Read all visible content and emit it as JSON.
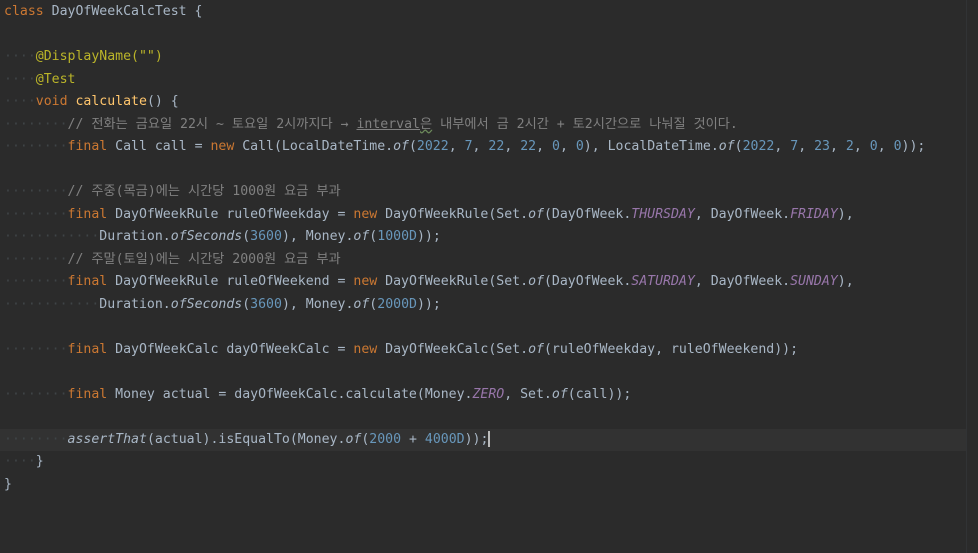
{
  "editor": {
    "file_language": "Java",
    "lines": [
      [
        [
          "kw",
          "class"
        ],
        [
          "t",
          " DayOfWeekCalcTest {"
        ]
      ],
      [],
      [
        [
          "ind",
          "····"
        ],
        [
          "anno",
          "@DisplayName(\"\")"
        ]
      ],
      [
        [
          "ind",
          "····"
        ],
        [
          "anno",
          "@Test"
        ]
      ],
      [
        [
          "ind",
          "····"
        ],
        [
          "kw",
          "void"
        ],
        [
          "t",
          " "
        ],
        [
          "fn",
          "calculate"
        ],
        [
          "t",
          "() {"
        ]
      ],
      [
        [
          "ind",
          "········"
        ],
        [
          "cmt",
          "// 전화는 금요일 22시 ~ 토요일 2시까지다 → "
        ],
        [
          "cmtlink",
          "interval"
        ],
        [
          "cmttypo",
          "은"
        ],
        [
          "cmt",
          " 내부에서 금 2시간 + 토2시간으로 나눠질 것이다."
        ]
      ],
      [
        [
          "ind",
          "········"
        ],
        [
          "kw",
          "final"
        ],
        [
          "t",
          " Call call = "
        ],
        [
          "kw",
          "new"
        ],
        [
          "t",
          " Call(LocalDateTime."
        ],
        [
          "it",
          "of"
        ],
        [
          "t",
          "("
        ],
        [
          "num",
          "2022"
        ],
        [
          "t",
          ", "
        ],
        [
          "num",
          "7"
        ],
        [
          "t",
          ", "
        ],
        [
          "num",
          "22"
        ],
        [
          "t",
          ", "
        ],
        [
          "num",
          "22"
        ],
        [
          "t",
          ", "
        ],
        [
          "num",
          "0"
        ],
        [
          "t",
          ", "
        ],
        [
          "num",
          "0"
        ],
        [
          "t",
          "), LocalDateTime."
        ],
        [
          "it",
          "of"
        ],
        [
          "t",
          "("
        ],
        [
          "num",
          "2022"
        ],
        [
          "t",
          ", "
        ],
        [
          "num",
          "7"
        ],
        [
          "t",
          ", "
        ],
        [
          "num",
          "23"
        ],
        [
          "t",
          ", "
        ],
        [
          "num",
          "2"
        ],
        [
          "t",
          ", "
        ],
        [
          "num",
          "0"
        ],
        [
          "t",
          ", "
        ],
        [
          "num",
          "0"
        ],
        [
          "t",
          "));"
        ]
      ],
      [],
      [
        [
          "ind",
          "········"
        ],
        [
          "cmt",
          "// 주중(목금)에는 시간당 1000원 요금 부과"
        ]
      ],
      [
        [
          "ind",
          "········"
        ],
        [
          "kw",
          "final"
        ],
        [
          "t",
          " DayOfWeekRule ruleOfWeekday = "
        ],
        [
          "kw",
          "new"
        ],
        [
          "t",
          " DayOfWeekRule(Set."
        ],
        [
          "it",
          "of"
        ],
        [
          "t",
          "(DayOfWeek."
        ],
        [
          "static",
          "THURSDAY"
        ],
        [
          "t",
          ", DayOfWeek."
        ],
        [
          "static",
          "FRIDAY"
        ],
        [
          "t",
          "),"
        ]
      ],
      [
        [
          "ind",
          "············"
        ],
        [
          "t",
          "Duration."
        ],
        [
          "it",
          "ofSeconds"
        ],
        [
          "t",
          "("
        ],
        [
          "num",
          "3600"
        ],
        [
          "t",
          "), Money."
        ],
        [
          "it",
          "of"
        ],
        [
          "t",
          "("
        ],
        [
          "num",
          "1000D"
        ],
        [
          "t",
          "));"
        ]
      ],
      [
        [
          "ind",
          "········"
        ],
        [
          "cmt",
          "// 주말(토일)에는 시간당 2000원 요금 부과"
        ]
      ],
      [
        [
          "ind",
          "········"
        ],
        [
          "kw",
          "final"
        ],
        [
          "t",
          " DayOfWeekRule ruleOfWeekend = "
        ],
        [
          "kw",
          "new"
        ],
        [
          "t",
          " DayOfWeekRule(Set."
        ],
        [
          "it",
          "of"
        ],
        [
          "t",
          "(DayOfWeek."
        ],
        [
          "static",
          "SATURDAY"
        ],
        [
          "t",
          ", DayOfWeek."
        ],
        [
          "static",
          "SUNDAY"
        ],
        [
          "t",
          "),"
        ]
      ],
      [
        [
          "ind",
          "············"
        ],
        [
          "t",
          "Duration."
        ],
        [
          "it",
          "ofSeconds"
        ],
        [
          "t",
          "("
        ],
        [
          "num",
          "3600"
        ],
        [
          "t",
          "), Money."
        ],
        [
          "it",
          "of"
        ],
        [
          "t",
          "("
        ],
        [
          "num",
          "2000D"
        ],
        [
          "t",
          "));"
        ]
      ],
      [],
      [
        [
          "ind",
          "········"
        ],
        [
          "kw",
          "final"
        ],
        [
          "t",
          " DayOfWeekCalc dayOfWeekCalc = "
        ],
        [
          "kw",
          "new"
        ],
        [
          "t",
          " DayOfWeekCalc(Set."
        ],
        [
          "it",
          "of"
        ],
        [
          "t",
          "(ruleOfWeekday, ruleOfWeekend));"
        ]
      ],
      [],
      [
        [
          "ind",
          "········"
        ],
        [
          "kw",
          "final"
        ],
        [
          "t",
          " Money actual = dayOfWeekCalc.calculate(Money."
        ],
        [
          "static",
          "ZERO"
        ],
        [
          "t",
          ", Set."
        ],
        [
          "it",
          "of"
        ],
        [
          "t",
          "(call));"
        ]
      ],
      [],
      [
        [
          "ind",
          "········"
        ],
        [
          "it",
          "assertThat"
        ],
        [
          "t",
          "(actual).isEqualTo(Money."
        ],
        [
          "it",
          "of"
        ],
        [
          "t",
          "("
        ],
        [
          "num",
          "2000"
        ],
        [
          "t",
          " + "
        ],
        [
          "num",
          "4000D"
        ],
        [
          "t",
          "));"
        ],
        [
          "caret",
          ""
        ]
      ],
      [
        [
          "ind",
          "····"
        ],
        [
          "t",
          "}"
        ]
      ],
      [
        [
          "t",
          "}"
        ]
      ]
    ],
    "current_line_index": 19,
    "colors": {
      "background": "#2b2b2b",
      "current_line": "#323232",
      "keyword": "#cc7832",
      "method_declaration": "#ffc66d",
      "annotation": "#bbb529",
      "string": "#6a8759",
      "number": "#6897bb",
      "comment": "#808080",
      "static_field": "#9876aa",
      "text": "#a9b7c6"
    }
  }
}
